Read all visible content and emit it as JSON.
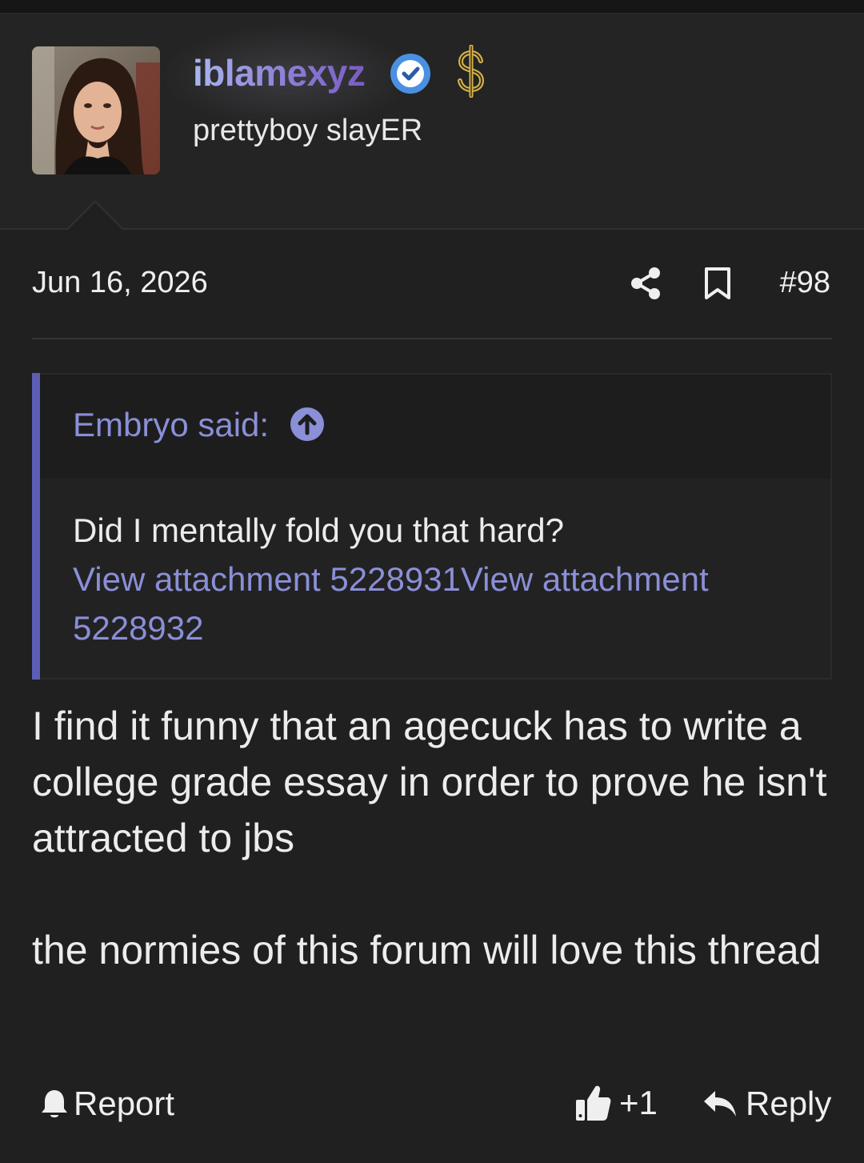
{
  "user": {
    "username": "iblamexyz",
    "title": "prettyboy slayER",
    "avatar_icon": "user-avatar-photo",
    "verified_icon": "verified-check-icon",
    "badge_icon": "dollar-sign-icon"
  },
  "post": {
    "date": "Jun 16, 2026",
    "number": "#98",
    "share_icon": "share-icon",
    "bookmark_icon": "bookmark-icon"
  },
  "quote": {
    "author_label": "Embryo said:",
    "text": "Did I mentally fold you that hard?",
    "attachment_1": "View attachment 5228931",
    "attachment_2": "View attachment 5228932"
  },
  "message": {
    "paragraph_1": "I find it funny that an agecuck has to write a college grade essay in order to prove he isn't attracted to jbs",
    "paragraph_2": "the normies of this forum will love this thread"
  },
  "actions": {
    "report_label": "Report",
    "like_count": "+1",
    "reply_label": "Reply"
  },
  "colors": {
    "background": "#202020",
    "accent": "#8a8fd8",
    "quote_bar": "#5c5eb6",
    "verified": "#4a90e2"
  }
}
